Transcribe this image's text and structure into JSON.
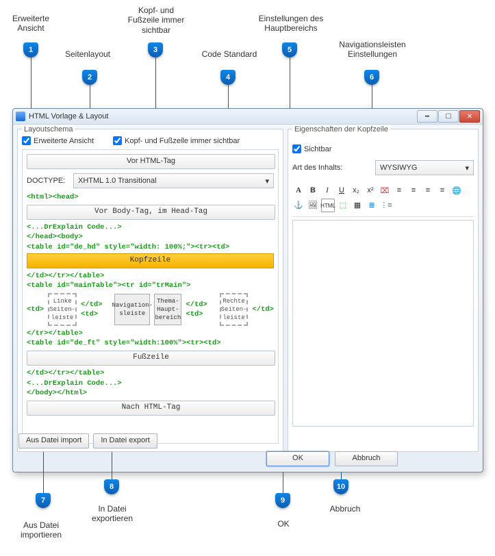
{
  "callouts": {
    "1": "Erweiterte Ansicht",
    "2": "Seitenlayout",
    "3": "Kopf- und Fußzeile immer sichtbar",
    "4": "Code Standard",
    "5": "Einstellungen des Hauptbereichs",
    "6": "Navigationsleisten Einstellungen",
    "7": "Aus Datei importieren",
    "8": "In Datei exportieren",
    "9": "OK",
    "10": "Abbruch"
  },
  "window": {
    "title": "HTML Vorlage & Layout"
  },
  "layout": {
    "group": "Layoutschema",
    "ext_view": "Erweiterte Ansicht",
    "header_footer_always": "Kopf- und Fußzeile immer sichtbar",
    "before_html": "Vor HTML-Tag",
    "doctype_label": "DOCTYPE:",
    "doctype_value": "XHTML 1.0 Transitional",
    "before_body": "Vor Body-Tag, im Head-Tag",
    "kopfzeile": "Kopfzeile",
    "fusszeile": "Fußzeile",
    "after_html": "Nach HTML-Tag",
    "linke": "Linke Seiten-leiste",
    "nav": "Navigation-sleiste",
    "thema": "Thema-Haupt-bereich",
    "rechte": "Rechte Seiten-leiste"
  },
  "code": {
    "l1": "<html><head>",
    "dre": "<...DrExplain Code...>",
    "l3": "</head><body>",
    "t1": "<table id=\"de_hd\" style=\"width: 100%;\"><tr><td>",
    "t1b": "</td></tr></table>",
    "t2": "<table id=\"mainTable\"><tr id=\"trMain\">",
    "t2b": "</tr></table>",
    "t3": "<table id=\"de_ft\" style=\"width:100%\"><tr><td>",
    "t3b": "</td></tr></table>",
    "last": "</body></html>"
  },
  "right": {
    "group": "Eigenschaften der Kopfzeile",
    "sichtbar": "Sichtbar",
    "art": "Art des Inhalts:",
    "wysiwyg": "WYSIWYG"
  },
  "buttons": {
    "import": "Aus Datei import",
    "export": "In Datei export",
    "ok": "OK",
    "cancel": "Abbruch"
  }
}
